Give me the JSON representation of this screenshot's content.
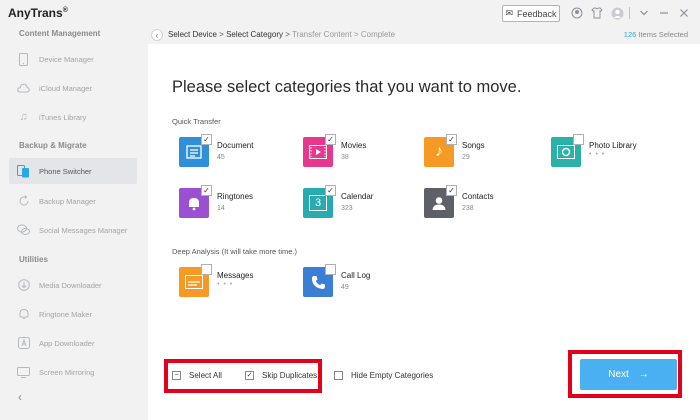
{
  "app": {
    "title": "AnyTrans",
    "title_mark": "®",
    "feedback_label": "Feedback"
  },
  "sidebar": {
    "sections": [
      {
        "title": "Content Management",
        "items": [
          "Device Manager",
          "iCloud Manager",
          "iTunes Library"
        ]
      },
      {
        "title": "Backup & Migrate",
        "items": [
          "Phone Switcher",
          "Backup Manager",
          "Social Messages Manager"
        ]
      },
      {
        "title": "Utilities",
        "items": [
          "Media Downloader",
          "Ringtone Maker",
          "App Downloader",
          "Screen Mirroring"
        ]
      }
    ],
    "active_item": "Phone Switcher"
  },
  "breadcrumb": {
    "steps": [
      "Select Device",
      "Select Category",
      "Transfer Content",
      "Complete"
    ],
    "separator": ">",
    "items_selected_count": "126",
    "items_selected_label": "Items Selected"
  },
  "main": {
    "heading": "Please select categories that you want to move.",
    "quick_transfer_label": "Quick Transfer",
    "deep_analysis_label": "Deep Analysis (It will take more time.)",
    "quick_transfer": [
      {
        "name": "Document",
        "count": "45",
        "checked": true,
        "color": "#2f8fd8",
        "icon": "document-icon"
      },
      {
        "name": "Movies",
        "count": "38",
        "checked": true,
        "color": "#e6388e",
        "icon": "movie-icon"
      },
      {
        "name": "Songs",
        "count": "29",
        "checked": true,
        "color": "#f59a25",
        "icon": "music-icon"
      },
      {
        "name": "Photo Library",
        "count": "• • •",
        "checked": false,
        "color": "#2bb2a8",
        "icon": "photo-icon"
      },
      {
        "name": "Ringtones",
        "count": "14",
        "checked": true,
        "color": "#9b4fd1",
        "icon": "bell-icon"
      },
      {
        "name": "Calendar",
        "count": "323",
        "checked": true,
        "color": "#27aab0",
        "icon": "calendar-icon"
      },
      {
        "name": "Contacts",
        "count": "238",
        "checked": true,
        "color": "#5d6066",
        "icon": "contacts-icon"
      }
    ],
    "calendar_day": "3",
    "deep_analysis": [
      {
        "name": "Messages",
        "count": "• • •",
        "checked": false,
        "color": "#f59a25",
        "icon": "messages-icon"
      },
      {
        "name": "Call Log",
        "count": "49",
        "checked": false,
        "color": "#3a7fd4",
        "icon": "phone-icon"
      }
    ]
  },
  "footer": {
    "select_all_label": "Select All",
    "skip_duplicates_label": "Skip Duplicates",
    "hide_empty_label": "Hide Empty Categories",
    "next_label": "Next",
    "select_all_state": "partial",
    "skip_duplicates_checked": true,
    "hide_empty_checked": false
  },
  "colors": {
    "accent": "#27a9e6",
    "next_button": "#4ab0f2",
    "highlight_box": "#e3001b"
  }
}
